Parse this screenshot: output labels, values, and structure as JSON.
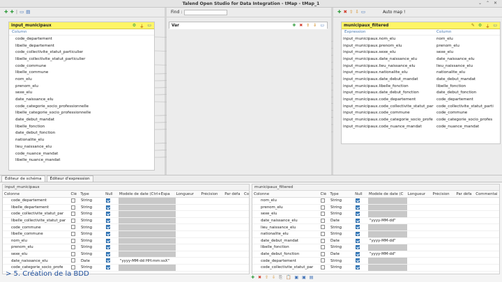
{
  "window": {
    "title": "Talend Open Studio for Data Integration - tMap - tMap_1"
  },
  "left_pane": {
    "table": {
      "name": "input_municipaux",
      "column_header": "Column",
      "rows": [
        "code_departement",
        "libelle_departement",
        "code_collectivite_statut_particulier",
        "libelle_collectivite_statut_particulier",
        "code_commune",
        "libelle_commune",
        "nom_elu",
        "prenom_elu",
        "sexe_elu",
        "date_naissance_elu",
        "code_categorie_socio_professionnelle",
        "libelle_categorie_socio_professionnelle",
        "date_debut_mandat",
        "libelle_fonction",
        "date_debut_fonction",
        "nationalite_elu",
        "lieu_naissance_elu",
        "code_nuance_mandat",
        "libelle_nuance_mandat"
      ]
    }
  },
  "middle_pane": {
    "find_label": "Find :",
    "var_table": {
      "name": "Var"
    }
  },
  "right_pane": {
    "auto_map_label": "Auto map !",
    "table": {
      "name": "municipaux_filtered",
      "expression_header": "Expression",
      "column_header": "Column",
      "rows": [
        {
          "expression": "input_municipaux.nom_elu",
          "column": "nom_elu"
        },
        {
          "expression": "input_municipaux.prenom_elu",
          "column": "prenom_elu"
        },
        {
          "expression": "input_municipaux.sexe_elu",
          "column": "sexe_elu"
        },
        {
          "expression": "input_municipaux.date_naissance_elu",
          "column": "date_naissance_elu"
        },
        {
          "expression": "input_municipaux.lieu_naissance_elu",
          "column": "lieu_naissance_elu"
        },
        {
          "expression": "input_municipaux.nationalite_elu",
          "column": "nationalite_elu"
        },
        {
          "expression": "input_municipaux.date_debut_mandat",
          "column": "date_debut_mandat"
        },
        {
          "expression": "input_municipaux.libelle_fonction",
          "column": "libelle_fonction"
        },
        {
          "expression": "input_municipaux.date_debut_fonction",
          "column": "date_debut_fonction"
        },
        {
          "expression": "input_municipaux.code_departement",
          "column": "code_departement"
        },
        {
          "expression": "input_municipaux.code_collectivite_statut_par",
          "column": "code_collectivite_statut_parti"
        },
        {
          "expression": "input_municipaux.code_commune",
          "column": "code_commune"
        },
        {
          "expression": "input_municipaux.code_categorie_socio_profe",
          "column": "code_categorie_socio_profes"
        },
        {
          "expression": "input_municipaux.code_nuance_mandat",
          "column": "code_nuance_mandat"
        }
      ]
    }
  },
  "bottom": {
    "tabs": [
      "Éditeur de schéma",
      "Éditeur d'expression"
    ],
    "left_schema": {
      "title": "input_municipaux",
      "headers": [
        "Colonne",
        "Clé",
        "Type",
        "Null",
        "Modèle de date (Ctrl+Espa",
        "Longueur",
        "Précision",
        "Par défa",
        "Cor"
      ],
      "rows": [
        {
          "name": "code_departement",
          "type": "String",
          "pattern": ""
        },
        {
          "name": "libelle_departement",
          "type": "String",
          "pattern": ""
        },
        {
          "name": "code_collectivite_statut_par",
          "type": "String",
          "pattern": ""
        },
        {
          "name": "libelle_collectivite_statut_par",
          "type": "String",
          "pattern": ""
        },
        {
          "name": "code_commune",
          "type": "String",
          "pattern": ""
        },
        {
          "name": "libelle_commune",
          "type": "String",
          "pattern": ""
        },
        {
          "name": "nom_elu",
          "type": "String",
          "pattern": ""
        },
        {
          "name": "prenom_elu",
          "type": "String",
          "pattern": ""
        },
        {
          "name": "sexe_elu",
          "type": "String",
          "pattern": ""
        },
        {
          "name": "date_naissance_elu",
          "type": "Date",
          "pattern": "\"yyyy-MM-dd HH:mm:ssX\""
        },
        {
          "name": "code_categorie_socio_profe",
          "type": "String",
          "pattern": ""
        }
      ]
    },
    "right_schema": {
      "title": "municipaux_filtered",
      "headers": [
        "Colonne",
        "Clé",
        "Type",
        "Null",
        "Modèle de date (C",
        "Longueur",
        "Précision",
        "Par défa",
        "Commentai"
      ],
      "rows": [
        {
          "name": "nom_elu",
          "type": "String",
          "pattern": ""
        },
        {
          "name": "prenom_elu",
          "type": "String",
          "pattern": ""
        },
        {
          "name": "sexe_elu",
          "type": "String",
          "pattern": ""
        },
        {
          "name": "date_naissance_elu",
          "type": "Date",
          "pattern": "\"yyyy-MM-dd\""
        },
        {
          "name": "lieu_naissance_elu",
          "type": "String",
          "pattern": ""
        },
        {
          "name": "nationalite_elu",
          "type": "String",
          "pattern": ""
        },
        {
          "name": "date_debut_mandat",
          "type": "Date",
          "pattern": "\"yyyy-MM-dd\""
        },
        {
          "name": "libelle_fonction",
          "type": "String",
          "pattern": ""
        },
        {
          "name": "date_debut_fonction",
          "type": "Date",
          "pattern": "\"yyyy-MM-dd\""
        },
        {
          "name": "code_departement",
          "type": "String",
          "pattern": ""
        },
        {
          "name": "code_collectivite_statut_par",
          "type": "String",
          "pattern": ""
        }
      ]
    }
  },
  "caption": "> 5. Création de la BDD",
  "colors": {
    "table_header": "#fff566",
    "column_header_text": "#4a7ab0",
    "caption": "#1f4f9c",
    "checkbox": "#3b82c4"
  }
}
